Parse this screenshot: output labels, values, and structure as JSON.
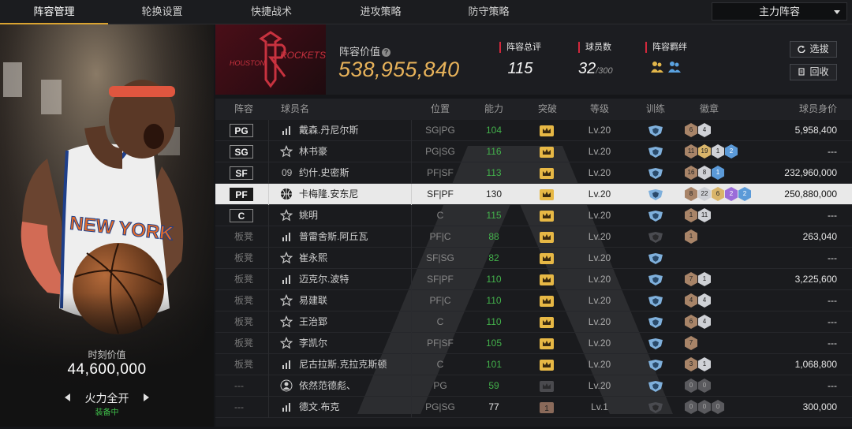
{
  "nav": {
    "tabs": [
      "阵容管理",
      "轮换设置",
      "快捷战术",
      "进攻策略",
      "防守策略"
    ],
    "active_tab": 0,
    "lineup_select": "主力阵容"
  },
  "player_panel": {
    "jersey_text": "NEW YORK",
    "moment_label": "时刻价值",
    "moment_value": "44,600,000",
    "fire_label": "火力全开",
    "equipped": "装备中"
  },
  "team": {
    "logo_text_left": "HOUSTON",
    "logo_text_right": "ROCKETS",
    "value_label": "阵容价值",
    "value": "538,955,840",
    "rating_label": "阵容总评",
    "rating": "115",
    "count_label": "球员数",
    "count": "32",
    "count_max": "/300",
    "bond_label": "阵容羁绊",
    "select_btn": "选拔",
    "recycle_btn": "回收"
  },
  "table": {
    "headers": [
      "阵容",
      "球员名",
      "位置",
      "能力",
      "突破",
      "等级",
      "训练",
      "徽章",
      "球员身价"
    ],
    "rows": [
      {
        "slot": "PG",
        "starter": true,
        "type": "bars",
        "name": "戴森.丹尼尔斯",
        "pos": "SG|PG",
        "ability": "104",
        "ability_color": "#43b14b",
        "breakthrough": "crown",
        "level": "Lv.20",
        "train": "blue",
        "badges": [
          [
            "bronze",
            "6"
          ],
          [
            "silver",
            "4"
          ]
        ],
        "price": "5,958,400"
      },
      {
        "slot": "SG",
        "starter": true,
        "type": "star",
        "name": "林书豪",
        "pos": "PG|SG",
        "ability": "116",
        "ability_color": "#43b14b",
        "breakthrough": "crown",
        "level": "Lv.20",
        "train": "blue",
        "badges": [
          [
            "bronze",
            "11"
          ],
          [
            "gold",
            "19"
          ],
          [
            "silver",
            "1"
          ],
          [
            "blue",
            "2"
          ]
        ],
        "price": "---"
      },
      {
        "slot": "SF",
        "starter": true,
        "type": "num",
        "num": "09",
        "name": "约什.史密斯",
        "pos": "PF|SF",
        "ability": "113",
        "ability_color": "#43b14b",
        "breakthrough": "crown",
        "level": "Lv.20",
        "train": "blue",
        "badges": [
          [
            "bronze",
            "16"
          ],
          [
            "silver",
            "8"
          ],
          [
            "blue",
            "1"
          ]
        ],
        "price": "232,960,000"
      },
      {
        "slot": "PF",
        "starter": true,
        "selected": true,
        "type": "ball",
        "name": "卡梅隆.安东尼",
        "pos": "SF|PF",
        "ability": "130",
        "ability_color": "#222222",
        "breakthrough": "crown",
        "level": "Lv.20",
        "train": "blue",
        "badges": [
          [
            "bronze",
            "8"
          ],
          [
            "silver",
            "22"
          ],
          [
            "gold",
            "6"
          ],
          [
            "purple",
            "2"
          ],
          [
            "blue",
            "2"
          ]
        ],
        "price": "250,880,000"
      },
      {
        "slot": "C",
        "starter": true,
        "type": "star",
        "name": "姚明",
        "pos": "C",
        "ability": "115",
        "ability_color": "#43b14b",
        "breakthrough": "crown",
        "level": "Lv.20",
        "train": "blue",
        "badges": [
          [
            "bronze",
            "1"
          ],
          [
            "silver",
            "11"
          ]
        ],
        "price": "---"
      },
      {
        "slot": "板凳",
        "starter": false,
        "type": "bars",
        "name": "普雷舍斯.阿丘瓦",
        "pos": "PF|C",
        "ability": "88",
        "ability_color": "#43b14b",
        "breakthrough": "crown",
        "level": "Lv.20",
        "train": "grey",
        "badges": [
          [
            "bronze",
            "1"
          ]
        ],
        "price": "263,040"
      },
      {
        "slot": "板凳",
        "starter": false,
        "type": "star",
        "name": "崔永熙",
        "pos": "SF|SG",
        "ability": "82",
        "ability_color": "#43b14b",
        "breakthrough": "crown",
        "level": "Lv.20",
        "train": "blue",
        "badges": [],
        "price": "---"
      },
      {
        "slot": "板凳",
        "starter": false,
        "type": "bars",
        "name": "迈克尔.波特",
        "pos": "SF|PF",
        "ability": "110",
        "ability_color": "#43b14b",
        "breakthrough": "crown",
        "level": "Lv.20",
        "train": "blue",
        "badges": [
          [
            "bronze",
            "7"
          ],
          [
            "silver",
            "1"
          ]
        ],
        "price": "3,225,600"
      },
      {
        "slot": "板凳",
        "starter": false,
        "type": "star",
        "name": "易建联",
        "pos": "PF|C",
        "ability": "110",
        "ability_color": "#43b14b",
        "breakthrough": "crown",
        "level": "Lv.20",
        "train": "blue",
        "badges": [
          [
            "bronze",
            "4"
          ],
          [
            "silver",
            "4"
          ]
        ],
        "price": "---"
      },
      {
        "slot": "板凳",
        "starter": false,
        "type": "star",
        "name": "王治郅",
        "pos": "C",
        "ability": "110",
        "ability_color": "#43b14b",
        "breakthrough": "crown",
        "level": "Lv.20",
        "train": "blue",
        "badges": [
          [
            "bronze",
            "6"
          ],
          [
            "silver",
            "4"
          ]
        ],
        "price": "---"
      },
      {
        "slot": "板凳",
        "starter": false,
        "type": "star",
        "name": "李凯尔",
        "pos": "PF|SF",
        "ability": "105",
        "ability_color": "#43b14b",
        "breakthrough": "crown",
        "level": "Lv.20",
        "train": "blue",
        "badges": [
          [
            "bronze",
            "7"
          ]
        ],
        "price": "---"
      },
      {
        "slot": "板凳",
        "starter": false,
        "type": "bars",
        "name": "尼古拉斯.克拉克斯顿",
        "pos": "C",
        "ability": "101",
        "ability_color": "#43b14b",
        "breakthrough": "crown",
        "level": "Lv.20",
        "train": "blue",
        "badges": [
          [
            "bronze",
            "3"
          ],
          [
            "silver",
            "1"
          ]
        ],
        "price": "1,068,800"
      },
      {
        "slot": "---",
        "starter": false,
        "type": "person",
        "name": "依然范德彪、",
        "pos": "PG",
        "ability": "59",
        "ability_color": "#43b14b",
        "breakthrough": "grey",
        "level": "Lv.20",
        "train": "blue",
        "badges": [
          [
            "grey",
            "0"
          ],
          [
            "grey",
            "0"
          ]
        ],
        "price": "---"
      },
      {
        "slot": "---",
        "starter": false,
        "type": "bars",
        "name": "德文.布克",
        "pos": "PG|SG",
        "ability": "77",
        "ability_color": "#e6e6e6",
        "breakthrough": "one",
        "level": "Lv.1",
        "train": "grey",
        "badges": [
          [
            "grey",
            "0"
          ],
          [
            "grey",
            "0"
          ],
          [
            "grey",
            "0"
          ]
        ],
        "price": "300,000"
      }
    ]
  },
  "colors": {
    "accent_gold": "#d9a330",
    "value_orange": "#e7b25a",
    "ability_green": "#43b14b",
    "equipped_green": "#3fbf4a",
    "stat_red": "#d2283c"
  },
  "icons": {
    "help": "question-circle-icon",
    "select": "refresh-icon",
    "recycle": "recycle-icon",
    "breakthrough": "crown-icon",
    "train": "shield-icon",
    "bond": "people-icon"
  }
}
